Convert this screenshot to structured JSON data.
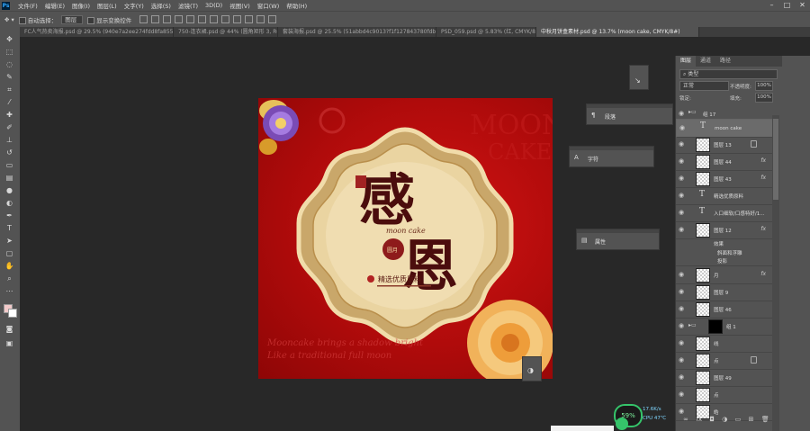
{
  "menu": [
    "文件(F)",
    "编辑(E)",
    "图像(I)",
    "图层(L)",
    "文字(Y)",
    "选择(S)",
    "滤镜(T)",
    "3D(D)",
    "视图(V)",
    "窗口(W)",
    "帮助(H)"
  ],
  "options": {
    "auto_select": "自动选择：",
    "auto_select_value": "图层",
    "show_transform": "显示变换控件"
  },
  "tabs": [
    "FC人气热卖海报.psd @ 29.5% (940e7a2ee274fdd8fa85533deb9f462a840191...",
    "750-连衣裙.psd @ 44% (圆角矩形 3, RGB/...",
    "套装海报.psd @ 25.5% (51abbd4c9013?f1f127843780fdb2d904fbcd401...",
    "PSD_059.psd @ 5.83% (红, CMYK/8...",
    "中秋月饼盒素材.psd @ 13.7% (moon cake, CMYK/8#)"
  ],
  "canvas": {
    "main_char_1": "感",
    "main_char_2": "恩",
    "moon_cake": "moon cake",
    "slogan": "精选优质原料",
    "seal": "圆月"
  },
  "panels": {
    "paragraph": "段落",
    "character": "字符",
    "properties": "属性"
  },
  "layers": {
    "tabs": [
      "图层",
      "通道",
      "路径"
    ],
    "filter_label": "类型",
    "blend_mode": "正常",
    "opacity_label": "不透明度:",
    "opacity": "100%",
    "lock_label": "锁定:",
    "fill_label": "填充:",
    "fill": "100%",
    "rows": [
      {
        "name": "组 17",
        "kind": "group"
      },
      {
        "name": "moon cake",
        "kind": "text"
      },
      {
        "name": "图层 13",
        "kind": "pixel"
      },
      {
        "name": "图层 44",
        "kind": "pixel"
      },
      {
        "name": "图层 43",
        "kind": "pixel"
      },
      {
        "name": "精选优质原料",
        "kind": "text"
      },
      {
        "name": "入口细软/口感特好/1...",
        "kind": "text"
      },
      {
        "name": "图层 12",
        "kind": "pixel"
      },
      {
        "name": "效果",
        "kind": "effect"
      },
      {
        "name": "斜面和浮雕",
        "kind": "effect"
      },
      {
        "name": "投影",
        "kind": "effect"
      },
      {
        "name": "月",
        "kind": "pixel"
      },
      {
        "name": "图层 9",
        "kind": "pixel"
      },
      {
        "name": "图层 46",
        "kind": "pixel"
      },
      {
        "name": "组 1",
        "kind": "group"
      },
      {
        "name": "线",
        "kind": "pixel"
      },
      {
        "name": "点",
        "kind": "pixel"
      },
      {
        "name": "图层 49",
        "kind": "pixel"
      },
      {
        "name": "点",
        "kind": "pixel"
      },
      {
        "name": "皓",
        "kind": "pixel"
      }
    ]
  },
  "tray": {
    "battery": "59%",
    "net": "17.6K/s",
    "cpu": "CPU 47℃"
  }
}
